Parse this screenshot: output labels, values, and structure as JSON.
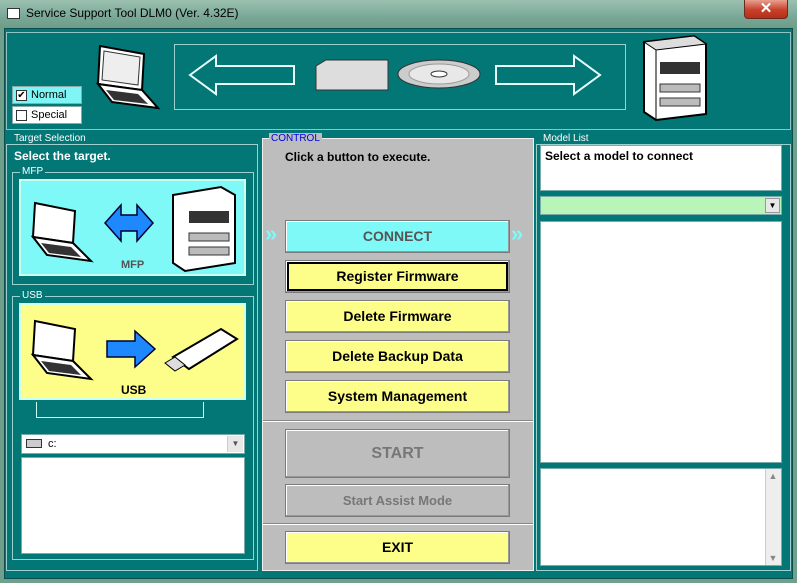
{
  "window": {
    "title": "Service Support Tool DLM0 (Ver. 4.32E)",
    "close_label": "✕"
  },
  "mode": {
    "normal_label": "Normal",
    "special_label": "Special",
    "normal_checked": true,
    "special_checked": false
  },
  "target": {
    "group_label": "Target Selection",
    "heading": "Select the target.",
    "mfp_label": "MFP",
    "mfp_caption": "MFP",
    "usb_label": "USB",
    "usb_caption": "USB",
    "drive_value": "c:"
  },
  "control": {
    "group_label": "CONTROL",
    "instruction": "Click a button to execute.",
    "connect": "CONNECT",
    "register_firmware": "Register Firmware",
    "delete_firmware": "Delete Firmware",
    "delete_backup": "Delete Backup Data",
    "system_management": "System Management",
    "start": "START",
    "start_assist": "Start Assist Mode",
    "exit": "EXIT",
    "chevrons": "»"
  },
  "model": {
    "group_label": "Model List",
    "prompt": "Select a model to connect",
    "select_value": ""
  },
  "colors": {
    "teal": "#037676",
    "cyan": "#7ff8f8",
    "yellow": "#fdfd8a",
    "green": "#b9f5b9"
  },
  "icons": [
    "laptop-icon",
    "arrow-left-icon",
    "usb-memory-icon",
    "cd-disc-icon",
    "arrow-right-icon",
    "mfp-printer-icon",
    "double-arrow-icon",
    "drive-icon",
    "chevron-icon"
  ]
}
